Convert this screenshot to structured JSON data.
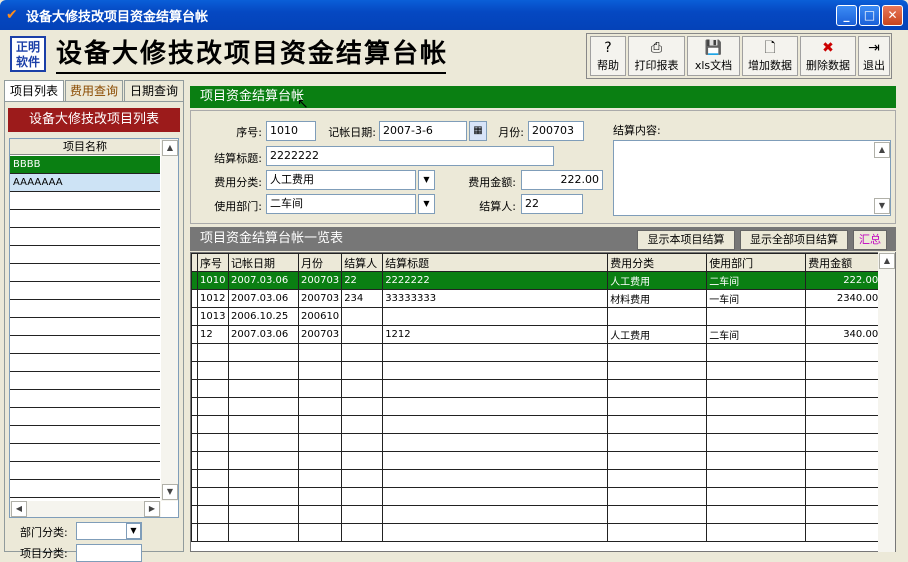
{
  "window": {
    "title": "设备大修技改项目资金结算台帐"
  },
  "app": {
    "logo_line1": "正明",
    "logo_line2": "软件",
    "title": "设备大修技改项目资金结算台帐"
  },
  "toolbar": [
    {
      "label": "帮助",
      "icon": "?"
    },
    {
      "label": "打印报表",
      "icon": "⎙"
    },
    {
      "label": "xls文档",
      "icon": "💾"
    },
    {
      "label": "增加数据",
      "icon": "🗋"
    },
    {
      "label": "删除数据",
      "icon": "✖"
    },
    {
      "label": "退出",
      "icon": "⇥"
    }
  ],
  "tabs": [
    "项目列表",
    "费用查询",
    "日期查询"
  ],
  "left": {
    "list_title": "设备大修技改项目列表",
    "column": "项目名称",
    "items": [
      "BBBB",
      "AAAAAAA"
    ],
    "dept_label": "部门分类:",
    "proj_label": "项目分类:"
  },
  "form": {
    "section_title": "项目资金结算台帐",
    "seq_label": "序号:",
    "seq": "1010",
    "date_label": "记帐日期:",
    "date": "2007-3-6",
    "month_label": "月份:",
    "month": "200703",
    "content_label": "结算内容:",
    "title_label": "结算标题:",
    "title": "2222222",
    "cat_label": "费用分类:",
    "cat": "人工费用",
    "amount_label": "费用金额:",
    "amount": "222.00",
    "dept_label": "使用部门:",
    "dept": "二车间",
    "person_label": "结算人:",
    "person": "22"
  },
  "list": {
    "title": "项目资金结算台帐一览表",
    "btn_current": "显示本项目结算",
    "btn_all": "显示全部项目结算",
    "btn_sum": "汇总",
    "columns": [
      "序号",
      "记帐日期",
      "月份",
      "结算人",
      "结算标题",
      "费用分类",
      "使用部门",
      "费用金额"
    ],
    "rows": [
      [
        "1010",
        "2007.03.06",
        "200703",
        "22",
        "2222222",
        "人工费用",
        "二车间",
        "222.00"
      ],
      [
        "1012",
        "2007.03.06",
        "200703",
        "234",
        "33333333",
        "材料费用",
        "一车间",
        "2340.00"
      ],
      [
        "1013",
        "2006.10.25",
        "200610",
        "",
        "",
        "",
        "",
        ""
      ],
      [
        "12",
        "2007.03.06",
        "200703",
        "",
        "1212",
        "人工费用",
        "二车间",
        "340.00"
      ]
    ]
  }
}
